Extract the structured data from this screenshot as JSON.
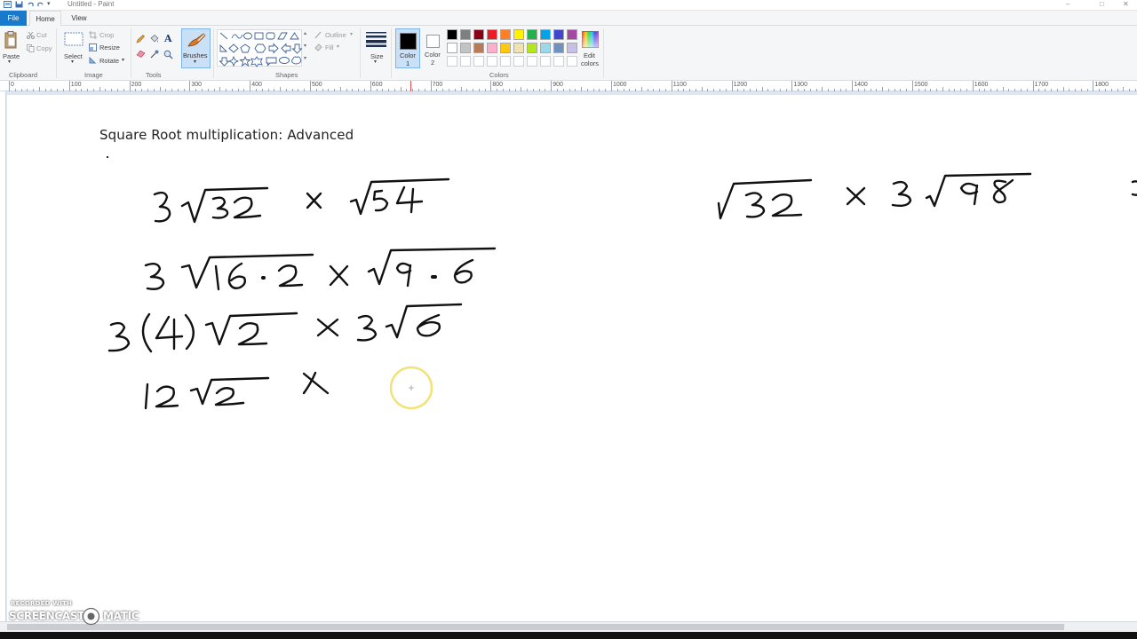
{
  "window": {
    "title": "Untitled - Paint"
  },
  "tabs": [
    {
      "label": "File"
    },
    {
      "label": "Home"
    },
    {
      "label": "View"
    }
  ],
  "ribbon": {
    "clipboard": {
      "paste": "Paste",
      "cut": "Cut",
      "copy": "Copy",
      "group": "Clipboard"
    },
    "image": {
      "select": "Select",
      "crop": "Crop",
      "resize": "Resize",
      "rotate": "Rotate",
      "group": "Image"
    },
    "tools": {
      "group": "Tools",
      "brushes": "Brushes"
    },
    "shapes": {
      "outline": "Outline",
      "fill": "Fill",
      "group": "Shapes"
    },
    "size": {
      "label": "Size"
    },
    "color1": {
      "label": "Color",
      "num": "1"
    },
    "color2": {
      "label": "Color",
      "num": "2"
    },
    "colors": {
      "group": "Colors",
      "edit_line1": "Edit",
      "edit_line2": "colors",
      "row1": [
        "#000000",
        "#7f7f7f",
        "#880015",
        "#ed1c24",
        "#ff7f27",
        "#fff200",
        "#22b14c",
        "#00a2e8",
        "#3f48cc",
        "#a349a4"
      ],
      "row2": [
        "#ffffff",
        "#c3c3c3",
        "#b97a57",
        "#ffaec9",
        "#ffc90e",
        "#efe4b0",
        "#b5e61d",
        "#99d9ea",
        "#7092be",
        "#c8bfe7"
      ]
    }
  },
  "ruler": {
    "ticks": [
      "0",
      "100",
      "200",
      "300",
      "400",
      "500",
      "600",
      "700",
      "800",
      "900",
      "1000",
      "1100",
      "1200",
      "1300",
      "1400",
      "1500",
      "1600",
      "1700",
      "1800"
    ]
  },
  "canvas": {
    "title": "Square Root multiplication: Advanced"
  },
  "watermark": {
    "line1": "RECORDED WITH",
    "line2": "SCREENCAST",
    "line3": "MATIC"
  },
  "colors": {
    "accent": "#1979ca",
    "ink": "#111111",
    "cursor_ring": "#f2e27a"
  }
}
